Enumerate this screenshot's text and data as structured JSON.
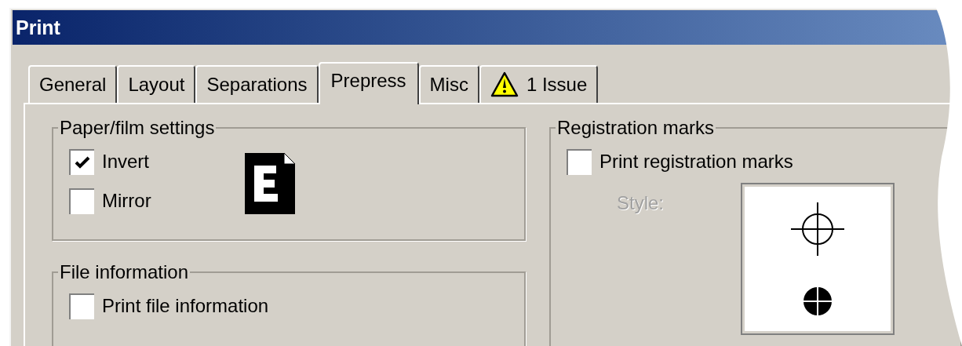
{
  "window": {
    "title": "Print"
  },
  "tabs": [
    {
      "label": "General",
      "selected": false,
      "kind": "plain"
    },
    {
      "label": "Layout",
      "selected": false,
      "kind": "plain"
    },
    {
      "label": "Separations",
      "selected": false,
      "kind": "plain"
    },
    {
      "label": "Prepress",
      "selected": true,
      "kind": "plain"
    },
    {
      "label": "Misc",
      "selected": false,
      "kind": "plain"
    },
    {
      "label": "1 Issue",
      "selected": false,
      "kind": "warning"
    }
  ],
  "groups": [
    {
      "title": "Paper/film settings",
      "checkboxes": [
        {
          "label": "Invert",
          "checked": true
        },
        {
          "label": "Mirror",
          "checked": false
        }
      ]
    },
    {
      "title": "File information",
      "checkboxes": [
        {
          "label": "Print file information",
          "checked": false
        }
      ]
    }
  ],
  "registration": {
    "title": "Registration marks",
    "checkbox": {
      "label": "Print registration marks",
      "checked": false
    },
    "style_label": {
      "text": "Style:",
      "disabled": true
    }
  }
}
